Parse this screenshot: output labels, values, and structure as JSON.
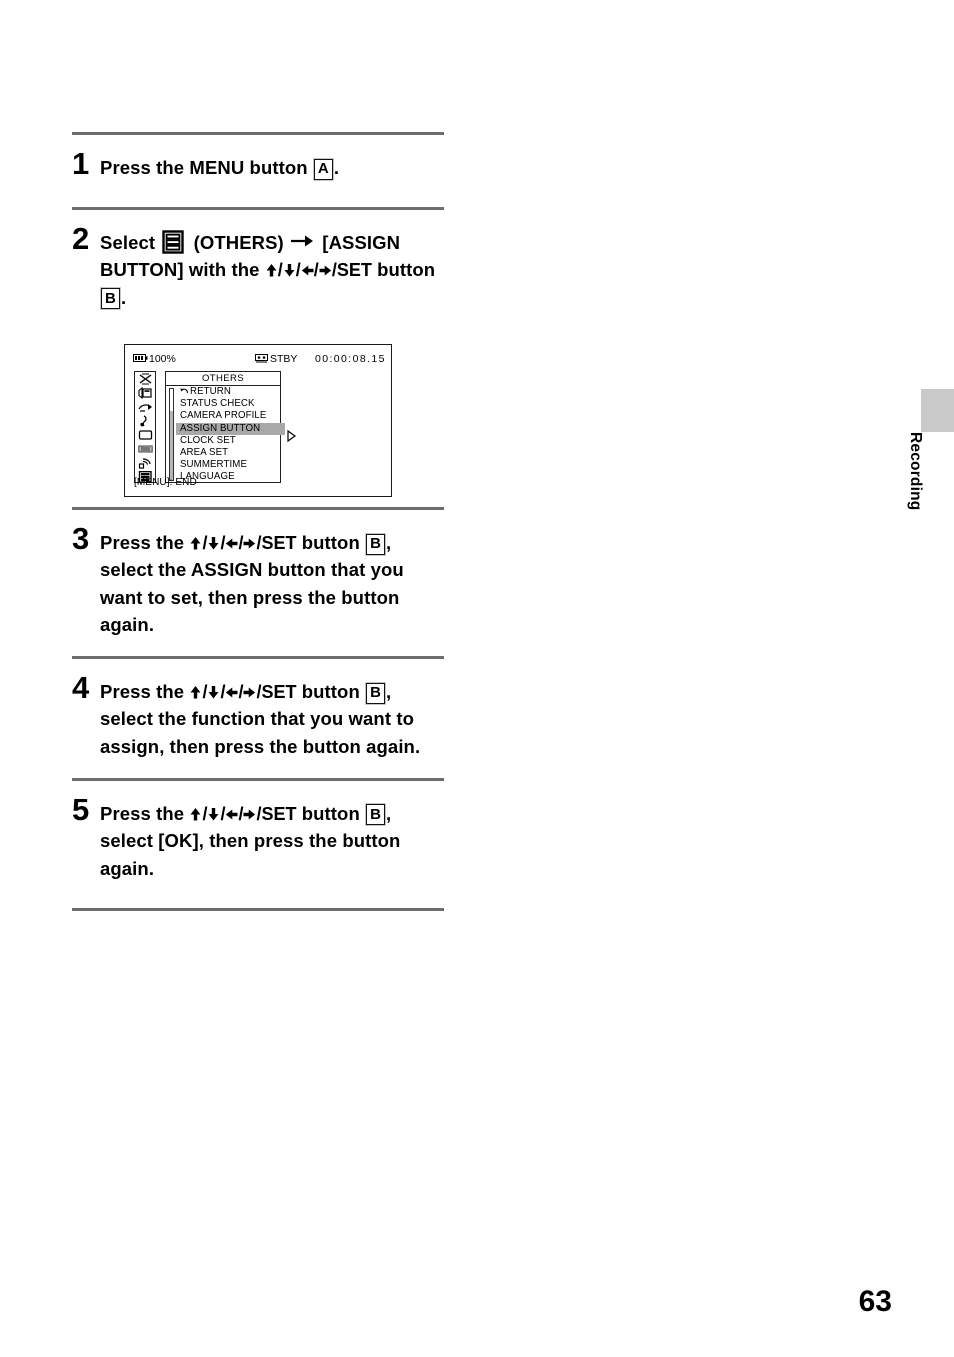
{
  "document": {
    "page_number": "63",
    "side_tab_label": "Recording"
  },
  "steps": [
    {
      "number": "1",
      "text_parts": {
        "lead": "Press the MENU button ",
        "key": "A",
        "tail": "."
      }
    },
    {
      "number": "2",
      "text_parts": {
        "lead": "Select ",
        "icon": "others-drawer-icon",
        "mid1": " (OTHERS) ",
        "arrow": "→",
        "mid2": " [ASSIGN BUTTON] with the ",
        "dpad": "▲/▼/◀/▶/SET",
        "mid3": " button ",
        "key": "B",
        "tail": "."
      }
    },
    {
      "number": "3",
      "text_parts": {
        "lead": "Press the ",
        "dpad": "▲/▼/◀/▶/SET",
        "mid1": " button ",
        "key": "B",
        "tail": ", select the ASSIGN button that you want to set, then press the button again."
      }
    },
    {
      "number": "4",
      "text_parts": {
        "lead": "Press the ",
        "dpad": "▲/▼/◀/▶/SET",
        "mid1": " button ",
        "key": "B",
        "tail": ", select the function that you want to assign, then press the button again."
      }
    },
    {
      "number": "5",
      "text_parts": {
        "lead": "Press the ",
        "dpad": "▲/▼/◀/▶/SET",
        "mid1": " button ",
        "key": "B",
        "tail": ", select [OK], then press the button again."
      }
    }
  ],
  "lcd_screen": {
    "status_bar": {
      "battery": "100%",
      "battery_icon": "battery-icon",
      "tape_icon": "tape-icon",
      "record_mode": "STBY",
      "timecode": "00:00:08.15"
    },
    "icon_rail": [
      "camera-set-icon",
      "audio-set-icon",
      "vcr-set-icon",
      "lcd-vf-set-icon",
      "tc-ub-set-icon",
      "memory-set-icon",
      "edit-set-icon",
      "others-icon"
    ],
    "menu_title": "OTHERS",
    "menu_items": [
      {
        "label": "RETURN",
        "has_return_arrow": true,
        "selected": false
      },
      {
        "label": "STATUS CHECK",
        "has_return_arrow": false,
        "selected": false
      },
      {
        "label": "CAMERA PROFILE",
        "has_return_arrow": false,
        "selected": false
      },
      {
        "label": "ASSIGN BUTTON",
        "has_return_arrow": false,
        "selected": true
      },
      {
        "label": "CLOCK SET",
        "has_return_arrow": false,
        "selected": false
      },
      {
        "label": "AREA SET",
        "has_return_arrow": false,
        "selected": false
      },
      {
        "label": "SUMMERTIME",
        "has_return_arrow": false,
        "selected": false
      },
      {
        "label": "LANGUAGE",
        "has_return_arrow": false,
        "selected": false
      }
    ],
    "submenu_arrow_icon": "triangle-right-icon",
    "footer": "[MENU]: END"
  },
  "colors": {
    "rule": "#6e6e6e",
    "selected_row": "#a8a8a8",
    "side_tab": "#c9c9c9",
    "text": "#000000"
  }
}
